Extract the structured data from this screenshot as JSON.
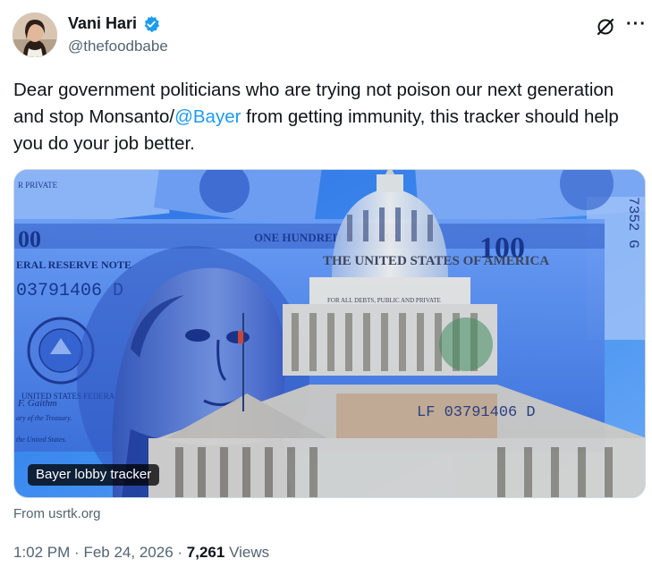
{
  "author": {
    "display_name": "Vani Hari",
    "handle": "@thefoodbabe",
    "verified": true
  },
  "tweet": {
    "text_before": "Dear government politicians who are trying not poison our next generation and stop Monsanto/",
    "mention": "@Bayer",
    "text_after": " from getting immunity, this tracker should help you do your job better."
  },
  "media": {
    "card_label": "Bayer lobby tracker",
    "source": "From usrtk.org",
    "bill_text": {
      "top_left": "ONE HUNDRED DOLLARS",
      "top_right": "100",
      "reserve_note": "ERAL RESERVE NOTE",
      "serial": "03791406 D",
      "serial_right": "LF 03791406 D",
      "united_states": "THE UNITED STATES OF AMERICA",
      "all_debts": "FOR ALL DEBTS, PUBLIC AND PRIVATE",
      "seal_text": "UNITED STATES FEDERAL RESERVE SYSTEM",
      "treasury": "ary of the Treasury.",
      "signature": "F. Gaithm",
      "united_states_small": "the United States.",
      "side_serial": "7352 G",
      "note_private": "R PRIVATE"
    }
  },
  "meta": {
    "time": "1:02 PM",
    "separator": "·",
    "date": "Feb 24, 2026",
    "views_count": "7,261",
    "views_label": "Views"
  },
  "icons": {
    "verified": "verified-badge-icon",
    "grok": "grok-icon",
    "more": "more-icon"
  },
  "colors": {
    "accent": "#1d9bf0",
    "secondary_text": "#536471"
  }
}
